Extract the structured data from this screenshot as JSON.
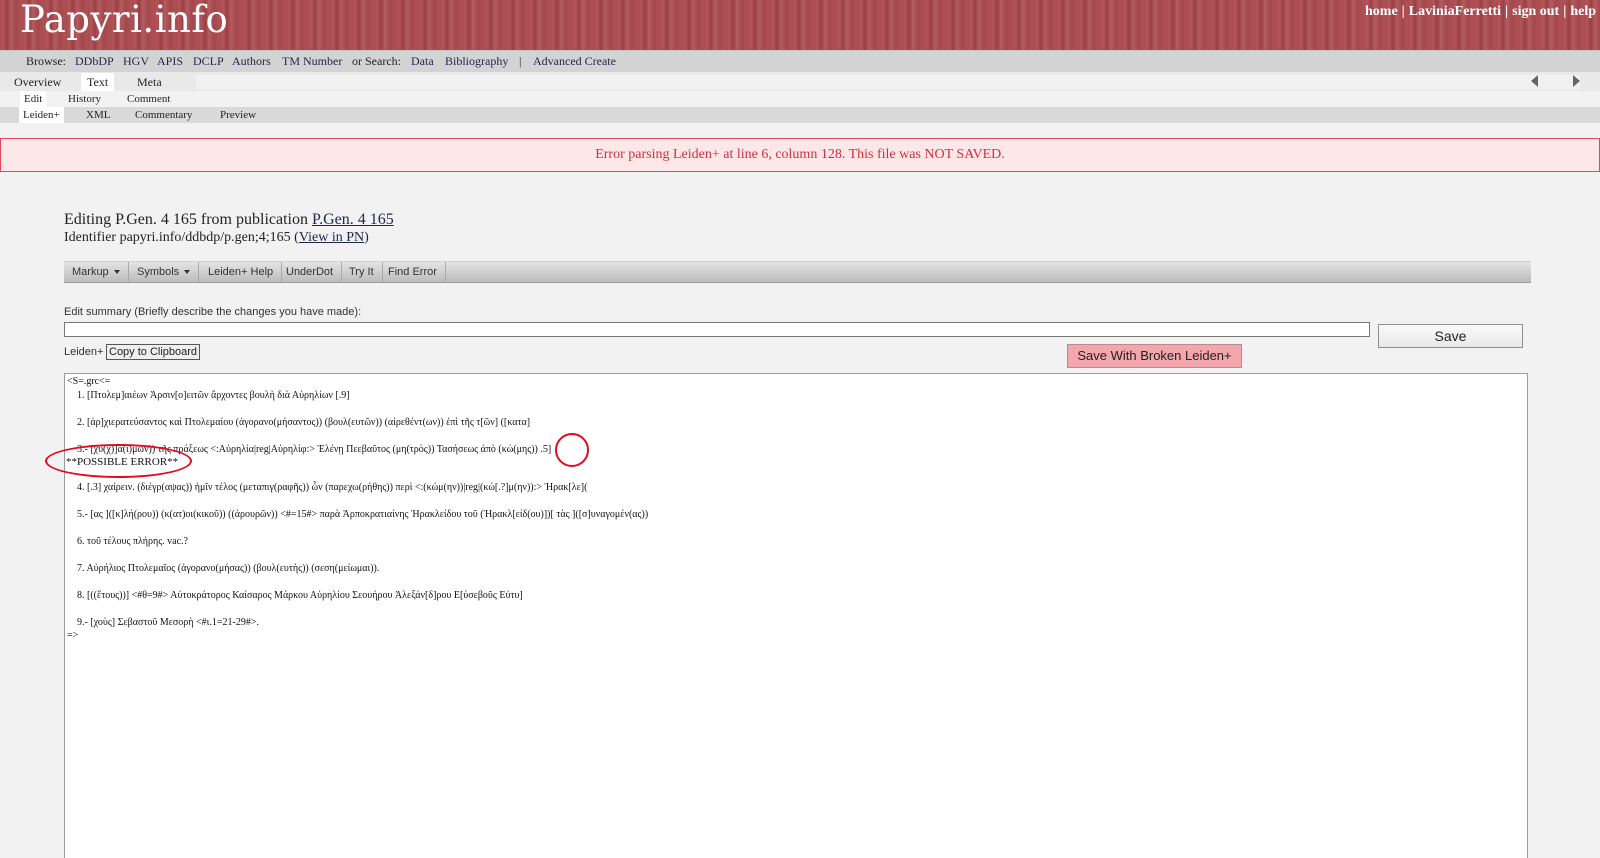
{
  "app": {
    "logo": "Papyri.info",
    "top_links": [
      "home",
      "LaviniaFerretti",
      "sign out",
      "help"
    ]
  },
  "browse": {
    "label": "Browse:",
    "links": [
      "DDbDP",
      "HGV",
      "APIS",
      "DCLP",
      "Authors",
      "TM Number"
    ],
    "search_label": "or Search:",
    "search_links": [
      "Data",
      "Bibliography"
    ],
    "divider": "|",
    "advanced": "Advanced Create"
  },
  "tabs": {
    "main": [
      "Overview",
      "Text",
      "Meta"
    ],
    "sub": [
      "Edit",
      "History",
      "Comment"
    ],
    "format": [
      "Leiden+",
      "XML",
      "Commentary",
      "Preview"
    ]
  },
  "error_message": "Error parsing Leiden+ at line 6, column 128. This file was NOT SAVED.",
  "editing": {
    "title_prefix": "Editing P.Gen. 4 165 from publication ",
    "publication_link": "P.Gen. 4 165",
    "identifier_prefix": "Identifier papyri.info/ddbdp/p.gen;4;165 (",
    "view_link": "View in PN",
    "identifier_suffix": ")"
  },
  "toolbar": {
    "buttons": [
      "Markup",
      "Symbols",
      "Leiden+ Help",
      "UnderDot",
      "Try It",
      "Find Error"
    ]
  },
  "form": {
    "summary_label": "Edit summary (Briefly describe the changes you have made):",
    "summary_value": "",
    "save_label": "Save",
    "leiden_label": "Leiden+",
    "copy_label": "Copy to Clipboard",
    "broken_label": "Save With Broken Leiden+"
  },
  "editor": {
    "lines": [
      "<S=.grc<=",
      "1. [Πτολεμ]αιέων Ἀρσιν[ο]ειτῶν ἄρχοντες βουλὴ διὰ Αὐρηλίων [.9]",
      "2. [ἀρ]χιερατεύσαντος καὶ Πτολεμαίου (ἀγορανο(μήσαντος)) (βουλ(ευτῶν)) (αἱρεθέντ(ων)) ἐπὶ τῆς τ[ῶν] ([κατα]",
      "3.- [χυ(χ)]α(ι)μῶν)) τῆς πράξεως <:Αὐρηλία|reg|Αὐρηλίφ:> Ἑλένῃ Πεεβαῦτος (μη(τρὸς)) Τασήσεως ἀπὸ (κώ(μης)) .5]",
      "**POSSIBLE ERROR**",
      "4. [.3] χαίρειν. (διέγρ(αψας)) ἡμῖν τέλος (μεταπιγ(ραφῆς)) ὧν (παρεχω(ρήθης)) περὶ <:(κώμ(ην))|reg|(κώ[.?]μ(ην)):> Ἡρακ[λε](",
      "5.- [ας ]([κ]λή(ρου)) (κ(ατ)οι(κικοῦ)) ((ἀρουρῶν)) <#=15#> παρὰ Ἁρποκρατιαίνης Ἡρακλείδου τοῦ (Ἡρακλ[είδ(ου)])[ τὰς ]([σ]υναγομέν(ας))",
      "6. τοῦ τέλους πλήρης. vac.?",
      "7. Αὐρήλιος Πτολεμαῖος (ἀγορανο(μήσας)) (βουλ(ευτὴς)) (σεση(μείωμαι)).",
      "8. [((ἔτους))] <#θ=9#> Αὐτοκράτορος Καίσαρος Μάρκου Αὐρηλίου Σεουήρου Ἀλεξάν[δ]ρου Ε[ὐσεβοῦς Εὐτυ]",
      "9.- [χοὺς] Σεβαστοῦ Μεσορὴ <#ι.1=21-29#>.",
      "=>"
    ]
  }
}
